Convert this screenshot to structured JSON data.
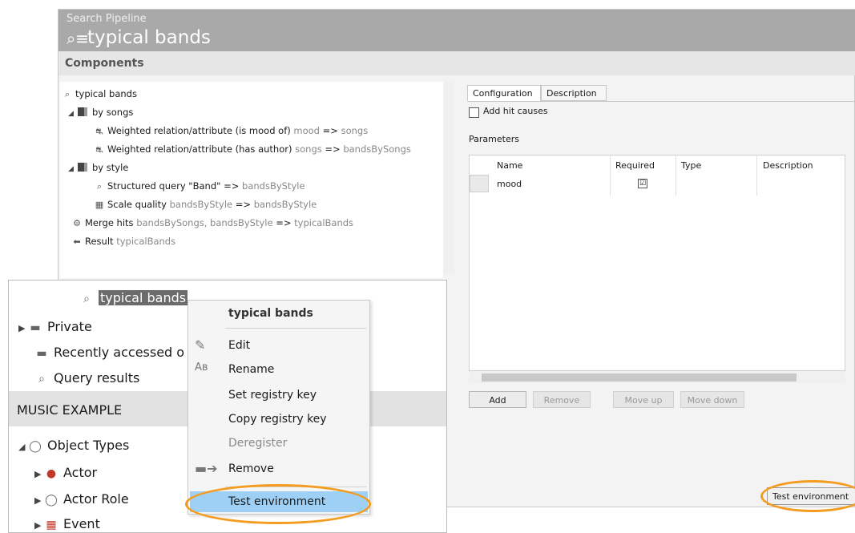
{
  "header": {
    "subtitle": "Search Pipeline",
    "title": "typical bands",
    "icons": "⌕≡"
  },
  "components": {
    "title": "Components"
  },
  "tree": {
    "root": "typical bands",
    "group1": "by songs",
    "g1_item1": {
      "label": "Weighted relation/attribute (is mood of)",
      "args": "mood",
      "arrow": "=>",
      "out": "songs"
    },
    "g1_item2": {
      "label": "Weighted relation/attribute (has author)",
      "args": "songs",
      "arrow": "=>",
      "out": "bandsBySongs"
    },
    "group2": "by style",
    "g2_item1": {
      "label": "Structured query \"Band\"",
      "arrow": "=>",
      "out": "bandsByStyle"
    },
    "g2_item2": {
      "label": "Scale quality",
      "args": "bandsByStyle",
      "arrow": "=>",
      "out": "bandsByStyle"
    },
    "merge": {
      "label": "Merge hits",
      "args": "bandsBySongs, bandsByStyle",
      "arrow": "=>",
      "out": "typicalBands"
    },
    "result": {
      "label": "Result",
      "out": "typicalBands"
    }
  },
  "tabs": {
    "configuration": "Configuration",
    "description": "Description"
  },
  "config": {
    "add_hit_causes": "Add hit causes",
    "parameters": "Parameters",
    "columns": [
      "Name",
      "Required",
      "Type",
      "Description"
    ],
    "rows": [
      {
        "name": "mood",
        "required": "☑"
      }
    ]
  },
  "buttons": {
    "add": "Add",
    "remove": "Remove",
    "move_up": "Move up",
    "move_down": "Move down",
    "test_env": "Test environment"
  },
  "explorer": {
    "search_label": "typical bands",
    "private": "Private",
    "recent": "Recently accessed o",
    "query_results": "Query results",
    "section": "MUSIC EXAMPLE",
    "object_types": "Object Types",
    "actor": "Actor",
    "actor_role": "Actor Role",
    "event": "Event"
  },
  "context_menu": {
    "title": "typical bands",
    "edit": "Edit",
    "rename": "Rename",
    "set_key": "Set registry key",
    "copy_key": "Copy registry key",
    "deregister": "Deregister",
    "remove": "Remove",
    "test_env": "Test environment"
  },
  "colors": {
    "highlight_ring": "#f39c1f",
    "menu_selected": "#9ed0f5",
    "header_bg": "#a9a9a9"
  }
}
